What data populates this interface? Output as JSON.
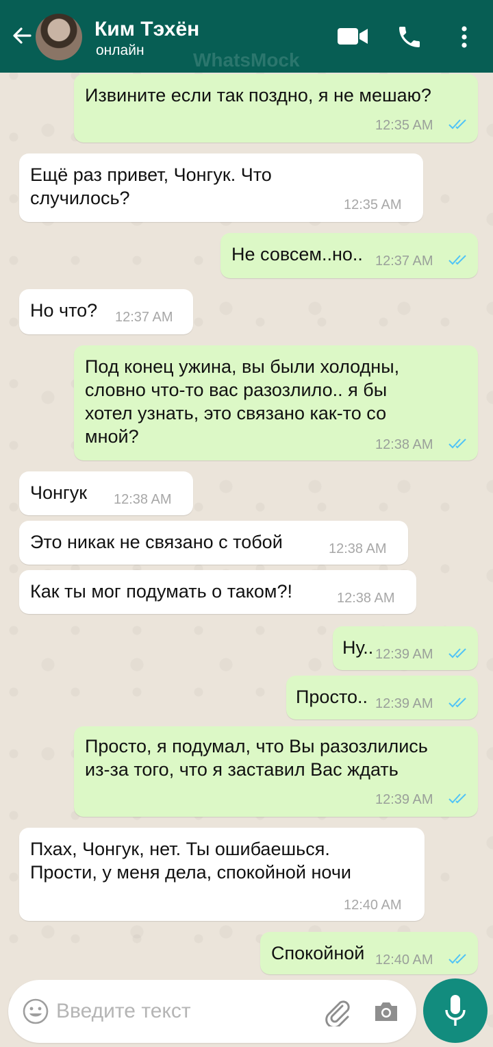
{
  "header": {
    "contact_name": "Ким Тэхён",
    "status": "онлайн",
    "watermark": "WhatsMock"
  },
  "messages": [
    {
      "dir": "out",
      "text": "Извините если так поздно, я не мешаю?",
      "time": "12:35 AM",
      "read": true
    },
    {
      "dir": "in",
      "text": "Ещё раз привет, Чонгук. Что\nслучилось?",
      "time": "12:35 AM"
    },
    {
      "dir": "out",
      "text": "Не совсем..но..",
      "time": "12:37 AM",
      "read": true
    },
    {
      "dir": "in",
      "text": "Но что?",
      "time": "12:37 AM"
    },
    {
      "dir": "out",
      "text": "Под конец ужина, вы были холодны,\nсловно что-то вас разозлило.. я бы\nхотел узнать, это связано как-то со\nмной?",
      "time": "12:38 AM",
      "read": true
    },
    {
      "dir": "in",
      "text": "Чонгук",
      "time": "12:38 AM"
    },
    {
      "dir": "in",
      "text": "Это никак не связано с тобой",
      "time": "12:38 AM"
    },
    {
      "dir": "in",
      "text": "Как ты мог подумать о таком?!",
      "time": "12:38 AM"
    },
    {
      "dir": "out",
      "text": "Ну..",
      "time": "12:39 AM",
      "read": true
    },
    {
      "dir": "out",
      "text": "Просто..",
      "time": "12:39 AM",
      "read": true
    },
    {
      "dir": "out",
      "text": "Просто, я подумал, что Вы разозлились\nиз-за того, что я заставил Вас ждать",
      "time": "12:39 AM",
      "read": true
    },
    {
      "dir": "in",
      "text": "Пхах, Чонгук, нет. Ты ошибаешься.\nПрости, у меня дела, спокойной ночи",
      "time": "12:40 AM"
    },
    {
      "dir": "out",
      "text": "Спокойной",
      "time": "12:40 AM",
      "read": true
    }
  ],
  "composer": {
    "placeholder": "Введите текст"
  },
  "colors": {
    "header": "#075e54",
    "outgoing_bubble": "#dcf8c6",
    "incoming_bubble": "#ffffff",
    "read_tick": "#4fc3f7",
    "mic_button": "#128c7e"
  },
  "icons": [
    "back-arrow-icon",
    "video-call-icon",
    "phone-icon",
    "menu-icon",
    "double-check-icon",
    "emoji-icon",
    "paperclip-icon",
    "camera-icon",
    "microphone-icon"
  ]
}
